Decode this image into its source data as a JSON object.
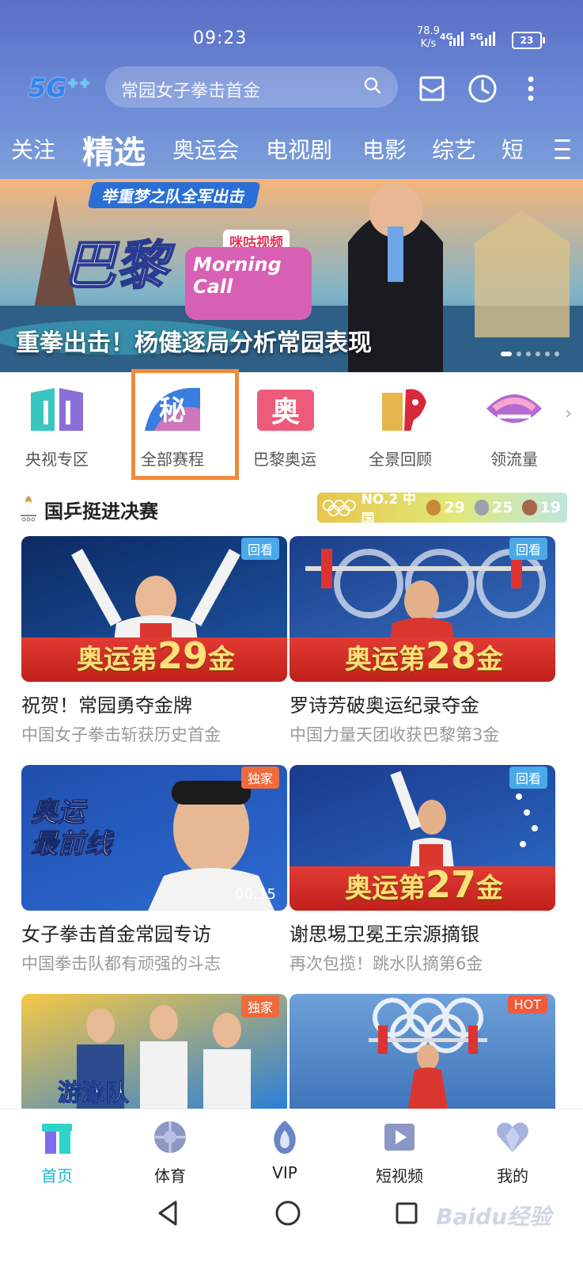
{
  "status": {
    "time": "09:23",
    "speed": "78.9",
    "speed_unit": "K/s",
    "net1": "4G",
    "net2": "5G",
    "battery": "23"
  },
  "header": {
    "logo": "5G",
    "logo_sup": "++",
    "search_placeholder": "常园女子拳击首金"
  },
  "tabs": [
    {
      "label": "关注"
    },
    {
      "label": "精选"
    },
    {
      "label": "奥运会"
    },
    {
      "label": "电视剧"
    },
    {
      "label": "电影"
    },
    {
      "label": "综艺"
    },
    {
      "label": "短"
    }
  ],
  "banner": {
    "top_tag": "举重梦之队全军出击",
    "title_art": "巴黎",
    "brand": "咪咕视频",
    "show": "Morning Call",
    "caption": "重拳出击！杨健逐局分析常园表现"
  },
  "shortcuts": [
    {
      "label": "央视专区",
      "icon": "cctv-icon",
      "color": "#38c6c0"
    },
    {
      "label": "全部赛程",
      "icon": "schedule-icon",
      "color": "#3a7de0"
    },
    {
      "label": "巴黎奥运",
      "icon": "paris-olympics-icon",
      "color": "#ee5b7a"
    },
    {
      "label": "全景回顾",
      "icon": "panorama-icon",
      "color": "#e6b64b"
    },
    {
      "label": "领流量",
      "icon": "data-gift-icon",
      "color": "#b569d3"
    }
  ],
  "section": {
    "title": "国乒挺进决赛",
    "medal_rank": "NO.2 中国",
    "gold": "29",
    "silver": "25",
    "bronze": "19"
  },
  "cards": [
    {
      "badge": "回看",
      "badge_color": "#4aa9e8",
      "overlay_pre": "奥运第",
      "overlay_num": "29",
      "overlay_post": "金",
      "title": "祝贺！常园勇夺金牌",
      "subtitle": "中国女子拳击斩获历史首金"
    },
    {
      "badge": "回看",
      "badge_color": "#4aa9e8",
      "overlay_pre": "奥运第",
      "overlay_num": "28",
      "overlay_post": "金",
      "title": "罗诗芳破奥运纪录夺金",
      "subtitle": "中国力量天团收获巴黎第3金"
    },
    {
      "badge": "独家",
      "badge_color": "#ef6a3c",
      "overlay_pre": "奥运",
      "overlay_num": "最前线",
      "overlay_post": "",
      "duration": "00:15",
      "title": "女子拳击首金常园专访",
      "subtitle": "中国拳击队都有顽强的斗志"
    },
    {
      "badge": "回看",
      "badge_color": "#4aa9e8",
      "overlay_pre": "奥运第",
      "overlay_num": "27",
      "overlay_post": "金",
      "title": "谢思埸卫冕王宗源摘银",
      "subtitle": "再次包揽！跳水队摘第6金"
    },
    {
      "badge": "独家",
      "badge_color": "#ef6a3c",
      "overlay_pre": "游泳队",
      "overlay_num": "",
      "overlay_post": "",
      "title": "",
      "subtitle": ""
    },
    {
      "badge": "HOT",
      "badge_color": "#ef5a3c",
      "overlay_pre": "",
      "overlay_num": "",
      "overlay_post": "",
      "title": "",
      "subtitle": ""
    }
  ],
  "bottom_nav": [
    {
      "label": "首页",
      "active": true
    },
    {
      "label": "体育",
      "active": false
    },
    {
      "label": "VIP",
      "active": false
    },
    {
      "label": "短视频",
      "active": false
    },
    {
      "label": "我的",
      "active": false
    }
  ],
  "watermark": "Baidu经验"
}
